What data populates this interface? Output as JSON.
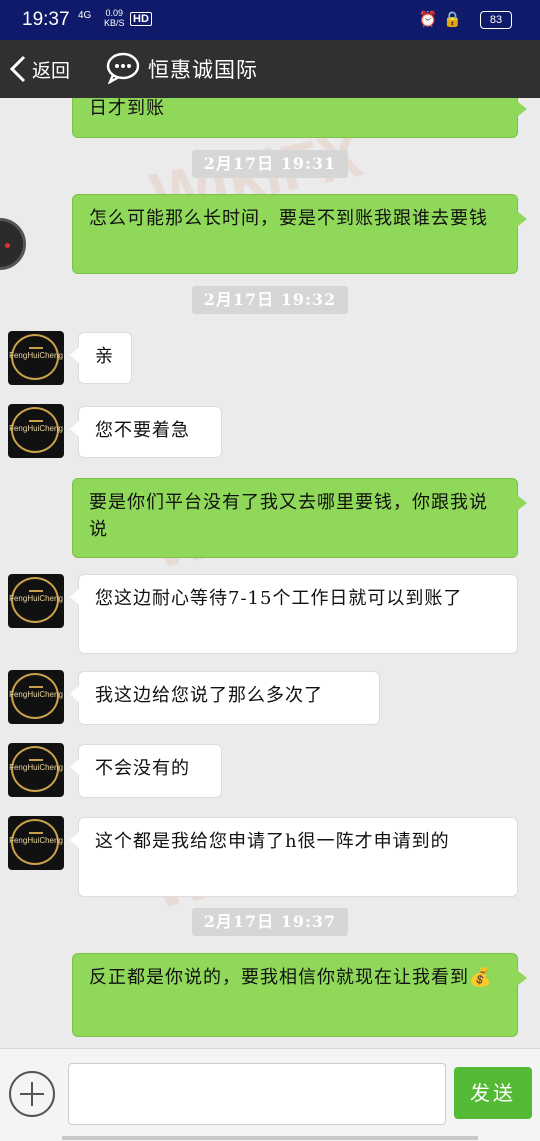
{
  "status_bar": {
    "time": "19:37",
    "network": "4G",
    "speed_value": "0.09",
    "speed_unit": "KB/S",
    "hd": "HD",
    "battery": "83"
  },
  "header": {
    "back_label": "返回",
    "title": "恒惠诚国际"
  },
  "watermark": "WikiFX",
  "avatar_text": "FengHuiCheng",
  "messages": [
    {
      "type": "out",
      "text": "日才到账"
    },
    {
      "type": "time",
      "text": "2月17日  19:31"
    },
    {
      "type": "out",
      "text": "怎么可能那么长时间，要是不到账我跟谁去要钱"
    },
    {
      "type": "time",
      "text": "2月17日  19:32"
    },
    {
      "type": "in",
      "text": "亲"
    },
    {
      "type": "in",
      "text": "您不要着急"
    },
    {
      "type": "out",
      "text": "要是你们平台没有了我又去哪里要钱，你跟我说说"
    },
    {
      "type": "in",
      "text": "您这边耐心等待7-15个工作日就可以到账了"
    },
    {
      "type": "in",
      "text": "我这边给您说了那么多次了"
    },
    {
      "type": "in",
      "text": "不会没有的"
    },
    {
      "type": "in",
      "text": "这个都是我给您申请了h很一阵才申请到的"
    },
    {
      "type": "time",
      "text": "2月17日  19:37"
    },
    {
      "type": "out",
      "text": "反正都是你说的，要我相信你就现在让我看到💰"
    }
  ],
  "input": {
    "placeholder": "",
    "send_label": "发送"
  }
}
